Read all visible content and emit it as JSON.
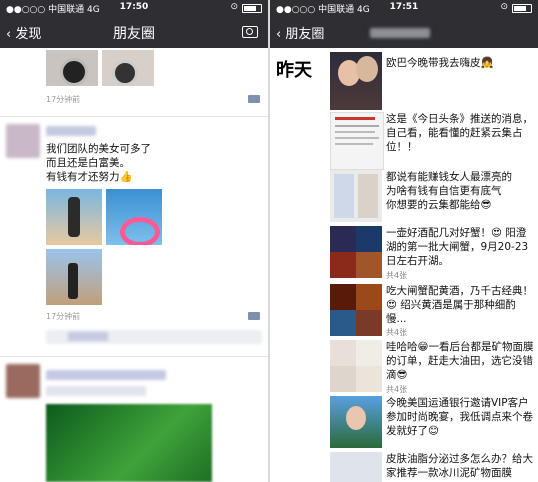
{
  "left": {
    "status": {
      "carrier": "●●○○○ 中国联通 4G",
      "time": "17:50"
    },
    "nav": {
      "back": "发现",
      "title": "朋友圈"
    },
    "post1": {
      "time": "17分钟前"
    },
    "post2": {
      "text": "我们团队的美女可多了\n而且还是白富美。\n有钱有才还努力👍",
      "time": "17分钟前"
    }
  },
  "right": {
    "status": {
      "carrier": "●●○○○ 中国联通 4G",
      "time": "17:51"
    },
    "nav": {
      "back": "朋友圈"
    },
    "date_label": "昨天",
    "items": [
      {
        "text": "欧巴今晚带我去嗨皮👧"
      },
      {
        "text": "这是《今日头条》推送的消息，自己看，能看懂的赶紧云集占位！！"
      },
      {
        "text": "都说有能赚钱女人最漂亮的\n为啥有钱有自信更有底气\n你想要的云集都能给😎"
      },
      {
        "text": "一壶好酒配几对好蟹！😍\n阳澄湖的第一批大闸蟹，9月20-23日左右开湖。",
        "count": "共4张"
      },
      {
        "text": "吃大闸蟹配黄酒，乃千古经典！😍\n绍兴黄酒是属于那种细酌慢...",
        "count": "共4张"
      },
      {
        "text": "哇哈哈😁一看后台都是矿物面膜的订单，赶走大油田，选它没错滴😎",
        "count": "共4张"
      },
      {
        "text": "今晚美国运通银行邀请VIP客户参加时尚晚宴，我低调点来个卷发就好了😊"
      },
      {
        "text": "皮肤油脂分泌过多怎么办？给大家推荐一款冰川泥矿物面膜"
      }
    ]
  }
}
